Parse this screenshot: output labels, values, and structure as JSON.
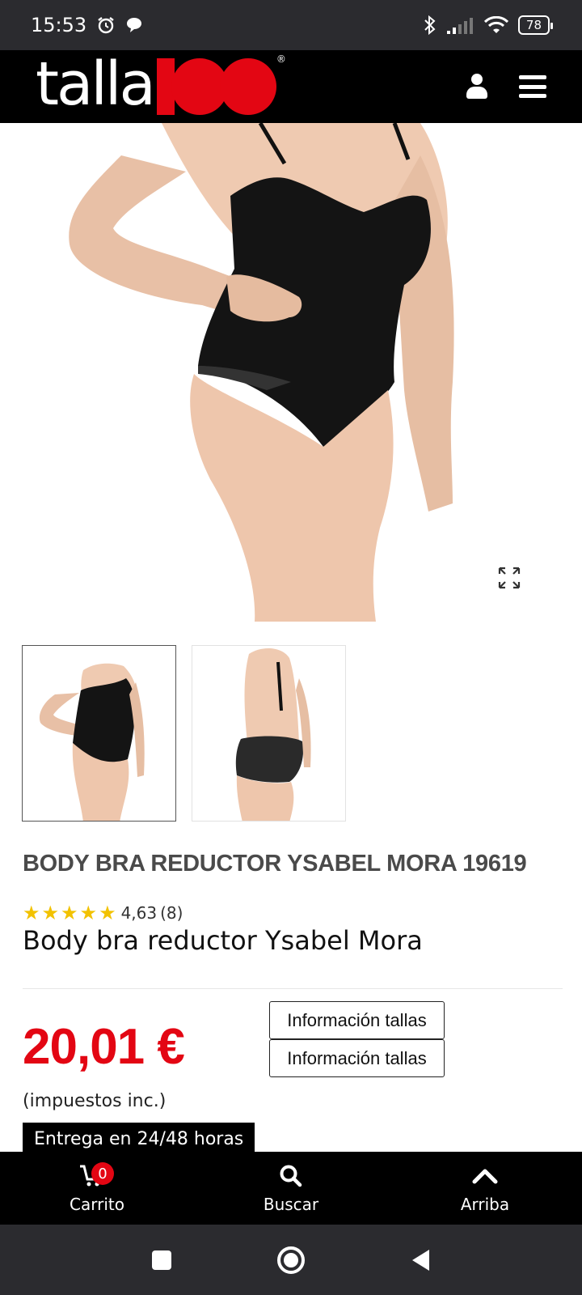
{
  "status_bar": {
    "time": "15:53",
    "battery": "78",
    "icons": [
      "alarm-icon",
      "chat-icon",
      "bluetooth-icon",
      "signal-icon",
      "wifi-icon",
      "battery-icon"
    ]
  },
  "header": {
    "logo_text": "talla",
    "logo_number": "100",
    "icons": [
      "user-icon",
      "menu-icon"
    ]
  },
  "product": {
    "title": "BODY BRA REDUCTOR YSABEL MORA 19619",
    "rating": {
      "stars": "★★★★★",
      "score": "4,63",
      "count": "(8)",
      "value": 4.63
    },
    "subtitle": "Body bra reductor Ysabel Mora",
    "price": "20,01 €",
    "tax_note": "(impuestos inc.)",
    "size_buttons": [
      "Información tallas",
      "Información tallas"
    ],
    "delivery": "Entrega en 24/48 horas"
  },
  "bottom_nav": {
    "items": [
      {
        "label": "Carrito",
        "icon": "cart-icon",
        "badge": "0"
      },
      {
        "label": "Buscar",
        "icon": "search-icon"
      },
      {
        "label": "Arriba",
        "icon": "chevron-up-icon"
      }
    ]
  },
  "colors": {
    "brand_red": "#e30613",
    "header_bg": "#000000",
    "star": "#f2c200"
  }
}
